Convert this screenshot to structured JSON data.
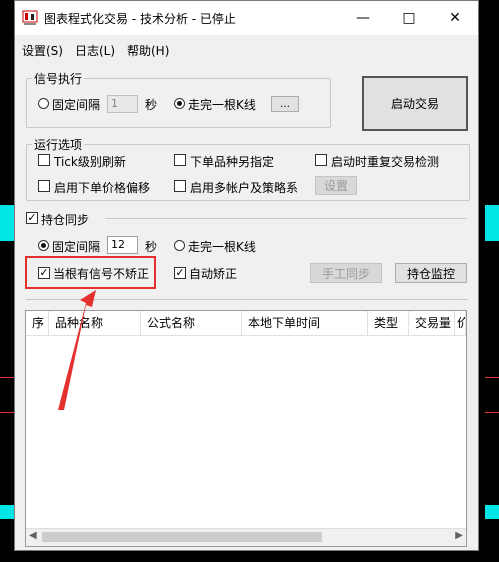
{
  "window": {
    "title": "图表程式化交易 - 技术分析 - 已停止",
    "minimize_symbol": "—",
    "maximize_symbol": "□",
    "close_symbol": "✕"
  },
  "menu": [
    "设置(S)",
    "日志(L)",
    "帮助(H)"
  ],
  "signal_exec": {
    "title": "信号执行",
    "fixed_interval_label": "固定间隔",
    "interval_value": "1",
    "seconds_label": "秒",
    "bar_label": "走完一根K线",
    "ellipsis_button": "…"
  },
  "start_button": "启动交易",
  "run_options": {
    "title": "运行选项",
    "items": [
      "Tick级别刷新",
      "下单品种另指定",
      "启动时重复交易检测",
      "启用下单价格偏移",
      "启用多帐户及策略系",
      "设置"
    ]
  },
  "position_sync": {
    "title": "持仓同步",
    "fixed_interval_label": "固定间隔",
    "interval_value": "12",
    "seconds_label": "秒",
    "bar_label": "走完一根K线",
    "no_signal_no_correct": "当根有信号不矫正",
    "auto_correct": "自动矫正",
    "manual_sync_button": "手工同步",
    "position_monitor_button": "持仓监控"
  },
  "table": {
    "columns": [
      "序",
      "品种名称",
      "公式名称",
      "本地下单时间",
      "类型",
      "交易量",
      "价"
    ]
  },
  "colors": {
    "highlight": "#e53030",
    "background_cyan": "#00e5e5"
  }
}
